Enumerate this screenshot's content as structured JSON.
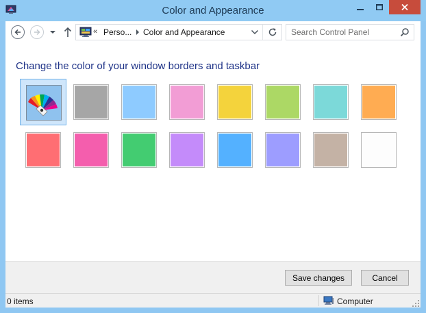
{
  "window": {
    "title": "Color and Appearance",
    "accent_color": "#90caf3",
    "close_color": "#c74c3c"
  },
  "address_bar": {
    "overflow": "«",
    "crumbs": [
      "Perso...",
      "Color and Appearance"
    ]
  },
  "search": {
    "placeholder": "Search Control Panel",
    "value": ""
  },
  "main": {
    "heading": "Change the color of your window borders and taskbar",
    "selected": "automatic",
    "swatches": [
      {
        "name": "automatic",
        "color": "#8fc2ee"
      },
      {
        "name": "gray",
        "color": "#a6a6a6"
      },
      {
        "name": "sky-blue",
        "color": "#8ecbff"
      },
      {
        "name": "pink",
        "color": "#f29dd5"
      },
      {
        "name": "yellow",
        "color": "#f4d33c"
      },
      {
        "name": "lime",
        "color": "#acd865"
      },
      {
        "name": "teal",
        "color": "#7cd9d9"
      },
      {
        "name": "orange",
        "color": "#ffac52"
      },
      {
        "name": "red",
        "color": "#ff6e73"
      },
      {
        "name": "magenta",
        "color": "#f45ead"
      },
      {
        "name": "green",
        "color": "#43cc71"
      },
      {
        "name": "violet",
        "color": "#c48bfa"
      },
      {
        "name": "blue",
        "color": "#54b1ff"
      },
      {
        "name": "periwinkle",
        "color": "#9d9dff"
      },
      {
        "name": "taupe",
        "color": "#c4b2a5"
      },
      {
        "name": "white",
        "color": "#fdfdfd"
      }
    ]
  },
  "footer": {
    "save_label": "Save changes",
    "cancel_label": "Cancel"
  },
  "status": {
    "items": "0 items",
    "location": "Computer"
  }
}
